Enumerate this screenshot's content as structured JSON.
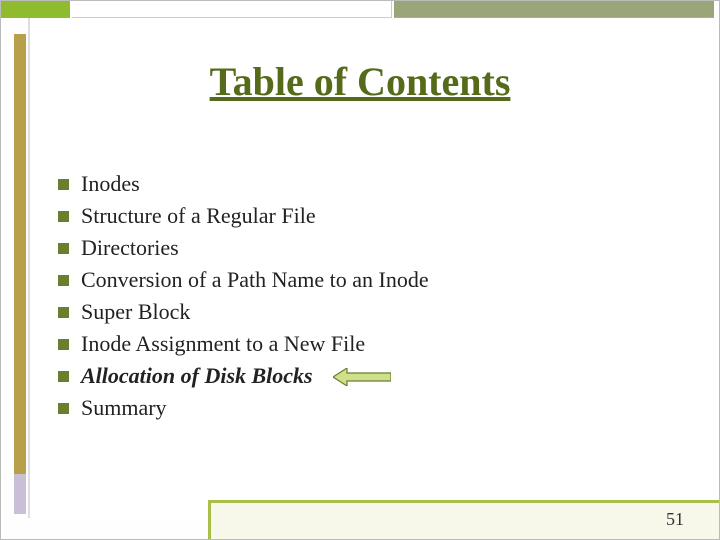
{
  "title": "Table of Contents",
  "items": [
    {
      "label": "Inodes",
      "highlight": false
    },
    {
      "label": "Structure of a Regular File",
      "highlight": false
    },
    {
      "label": "Directories",
      "highlight": false
    },
    {
      "label": "Conversion of a Path Name to an Inode",
      "highlight": false
    },
    {
      "label": "Super Block",
      "highlight": false
    },
    {
      "label": "Inode Assignment to a New File",
      "highlight": false
    },
    {
      "label": "Allocation of Disk Blocks",
      "highlight": true
    },
    {
      "label": "Summary",
      "highlight": false
    }
  ],
  "page_number": "51",
  "colors": {
    "title": "#556b1a",
    "bullet": "#6b7d2e",
    "accent_lime": "#8fbc2e",
    "accent_olive": "#b8a04a",
    "frame_green": "#a8c04a"
  }
}
